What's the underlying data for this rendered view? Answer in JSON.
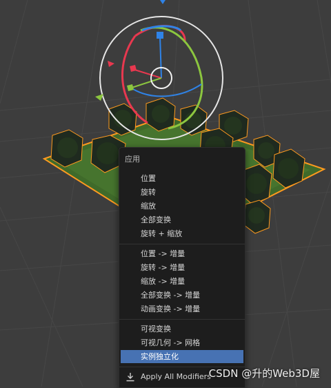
{
  "menu": {
    "title": "应用",
    "items": [
      "位置",
      "旋转",
      "缩放",
      "全部变换",
      "旋转 + 缩放",
      "位置 -> 增量",
      "旋转 -> 增量",
      "缩放 -> 增量",
      "全部变换 -> 增量",
      "动画变换 -> 增量",
      "可视变换",
      "可视几何 -> 网格",
      "实例独立化",
      "Apply All Modifiers"
    ],
    "highlighted_item": "实例独立化",
    "icons": {
      "apply_all_modifiers": "download-arrow-icon"
    }
  },
  "watermark": "CSDN @升的Web3D屋",
  "colors": {
    "viewport_bg": "#3d3d3d",
    "menu_bg": "#1d1d1d",
    "highlight": "#4772b3",
    "selection_outline": "#ff9a1f",
    "gizmo_red": "#e8384f",
    "gizmo_green": "#8cc63f",
    "gizmo_blue": "#2f83e7"
  }
}
